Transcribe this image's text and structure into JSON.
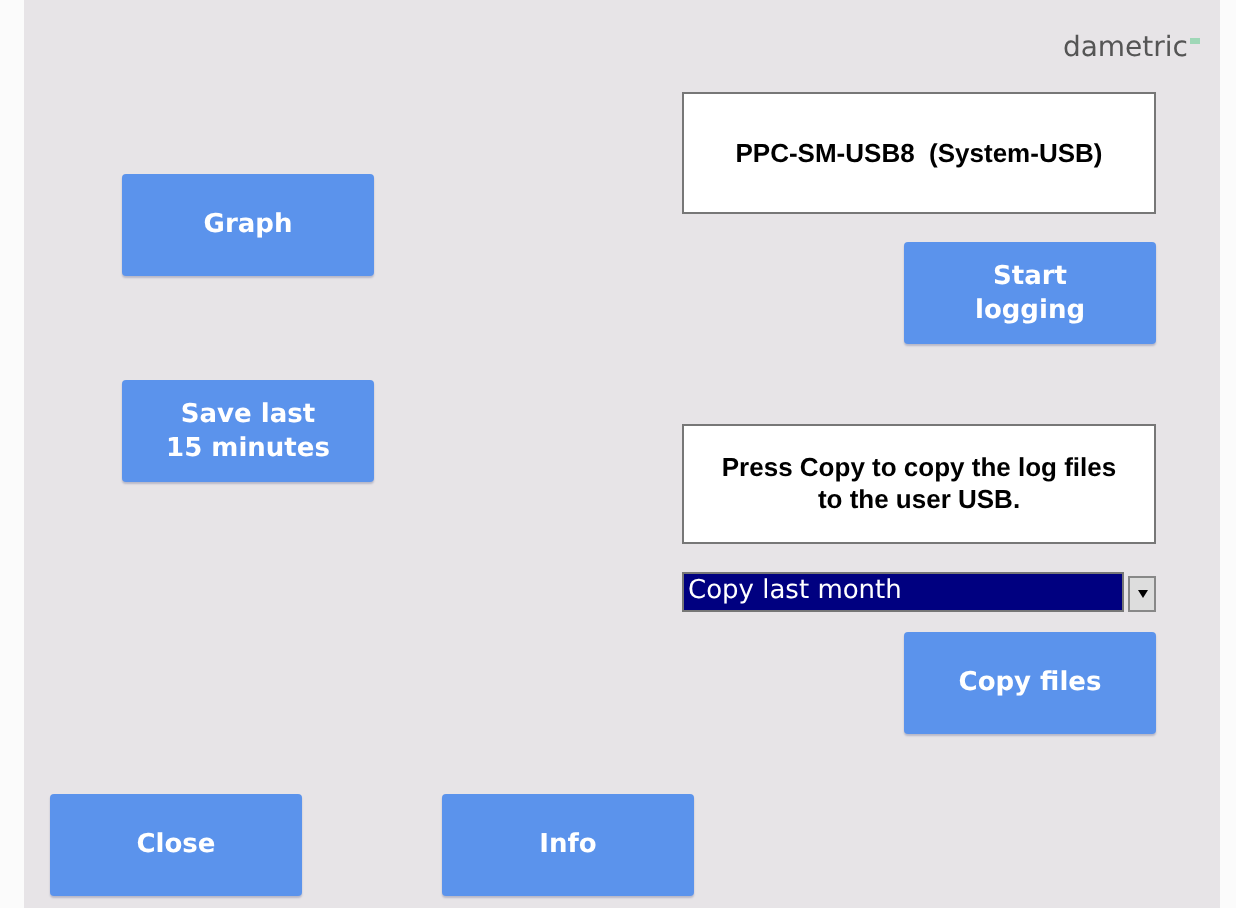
{
  "logo": "dametric",
  "device": {
    "label": "PPC-SM-USB8  (System-USB)"
  },
  "left_buttons": [
    "Graph",
    "Save last\n15 minutes"
  ],
  "start_button": "Start\nlogging",
  "message": "Press Copy to copy the log files\nto the user USB.",
  "copy_dropdown": {
    "value": "Copy last month",
    "highlighted": true
  },
  "copy_button": "Copy files",
  "bottom_buttons": [
    "Close",
    "Info"
  ]
}
